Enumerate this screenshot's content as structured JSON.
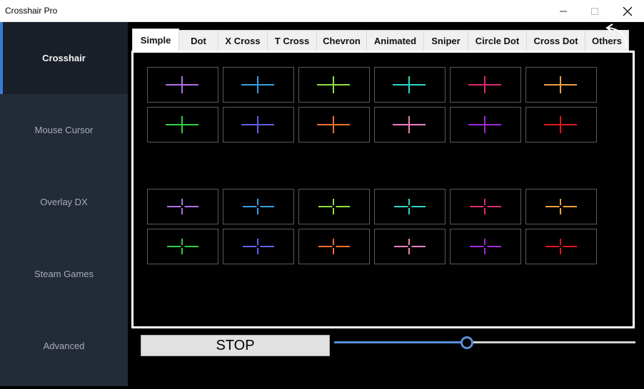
{
  "window": {
    "title": "Crosshair Pro",
    "controls": [
      "minimize-icon",
      "maximize-icon",
      "close-icon"
    ]
  },
  "sidebar": {
    "items": [
      {
        "label": "Crosshair",
        "active": true
      },
      {
        "label": "Mouse Cursor",
        "active": false
      },
      {
        "label": "Overlay DX",
        "active": false
      },
      {
        "label": "Steam Games",
        "active": false
      },
      {
        "label": "Advanced",
        "active": false
      }
    ]
  },
  "tabs": [
    {
      "label": "Simple",
      "active": true
    },
    {
      "label": "Dot",
      "active": false
    },
    {
      "label": "X Cross",
      "active": false
    },
    {
      "label": "T Cross",
      "active": false
    },
    {
      "label": "Chevron",
      "active": false
    },
    {
      "label": "Animated",
      "active": false
    },
    {
      "label": "Sniper",
      "active": false
    },
    {
      "label": "Circle Dot",
      "active": false
    },
    {
      "label": "Cross Dot",
      "active": false
    },
    {
      "label": "Others",
      "active": false
    }
  ],
  "crosshair_groups": [
    {
      "style": "cross",
      "rows": [
        [
          "#b070e8",
          "#3aa0e0",
          "#90e040",
          "#30d8c8",
          "#e02870",
          "#f0a040"
        ],
        [
          "#30d040",
          "#6060e8",
          "#f07030",
          "#f080c0",
          "#a028d8",
          "#e01818"
        ]
      ]
    },
    {
      "style": "cross-gap",
      "rows": [
        [
          "#b070e8",
          "#3aa0e0",
          "#90e040",
          "#30d8c8",
          "#e02870",
          "#f0a040"
        ],
        [
          "#30d040",
          "#6060e8",
          "#f07030",
          "#f080c0",
          "#a028d8",
          "#e01818"
        ]
      ]
    }
  ],
  "controls": {
    "stop_label": "STOP",
    "slider_value": 0.44
  },
  "colors": {
    "sidebar_bg": "#232b38",
    "sidebar_active_bg": "#1a202a",
    "accent": "#3a7bd5",
    "slider_accent": "#5b8fd6"
  }
}
